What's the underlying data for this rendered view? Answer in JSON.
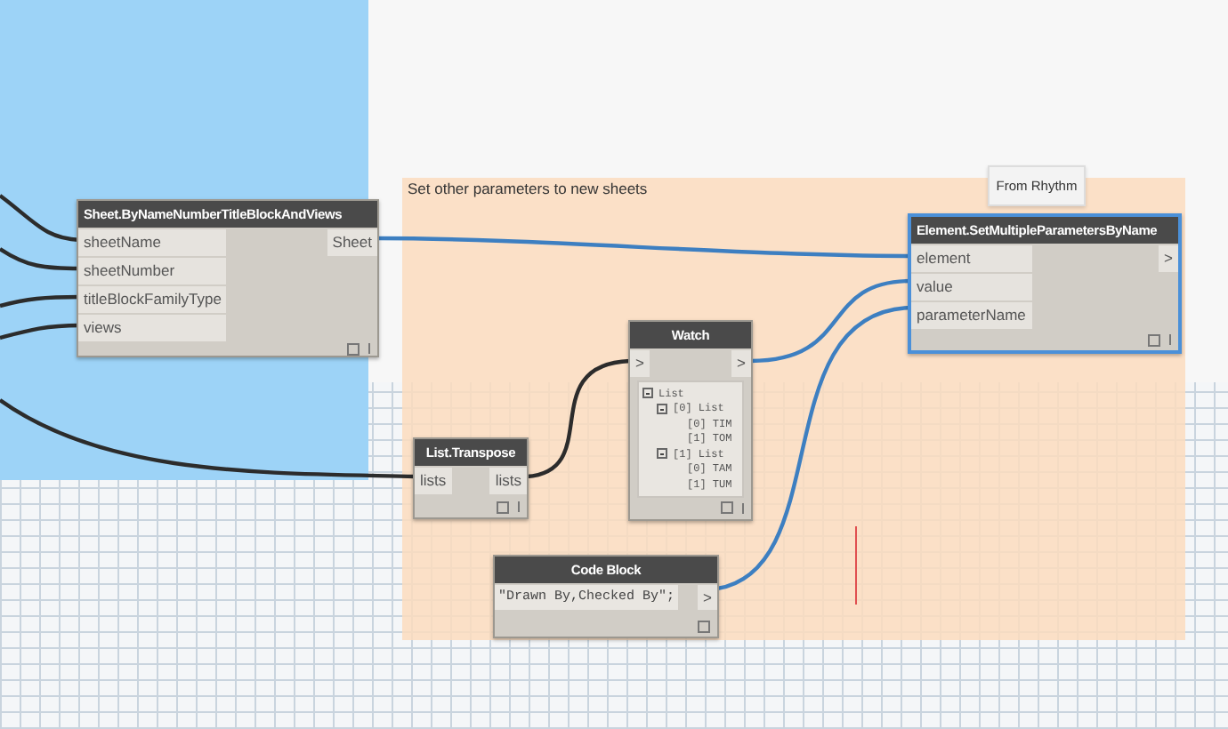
{
  "group": {
    "title": "Set other parameters to new sheets"
  },
  "tooltip": {
    "text": "From Rhythm"
  },
  "sheet_node": {
    "title": "Sheet.ByNameNumberTitleBlockAndViews",
    "selected": false,
    "inputs": [
      "sheetName",
      "sheetNumber",
      "titleBlockFamilyType",
      "views"
    ],
    "outputs": [
      "Sheet"
    ]
  },
  "element_node": {
    "title": "Element.SetMultipleParametersByName",
    "selected": true,
    "inputs": [
      "element",
      "value",
      "parameterName"
    ],
    "outputs": [
      ">"
    ]
  },
  "watch_node": {
    "title": "Watch",
    "selected": false,
    "inputs": [
      ">"
    ],
    "outputs": [
      ">"
    ],
    "tree": {
      "label": "List",
      "expanded": true,
      "children": [
        {
          "label": "[0] List",
          "expanded": true,
          "children": [
            {
              "label": "[0] TIM"
            },
            {
              "label": "[1] TOM"
            }
          ]
        },
        {
          "label": "[1] List",
          "expanded": true,
          "children": [
            {
              "label": "[0] TAM"
            },
            {
              "label": "[1] TUM"
            }
          ]
        }
      ]
    }
  },
  "transpose_node": {
    "title": "List.Transpose",
    "selected": false,
    "inputs": [
      "lists"
    ],
    "outputs": [
      "lists"
    ]
  },
  "code_block_node": {
    "title": "Code Block",
    "selected": false,
    "code": "\"Drawn By,Checked By\";",
    "outputs": [
      ">"
    ]
  }
}
